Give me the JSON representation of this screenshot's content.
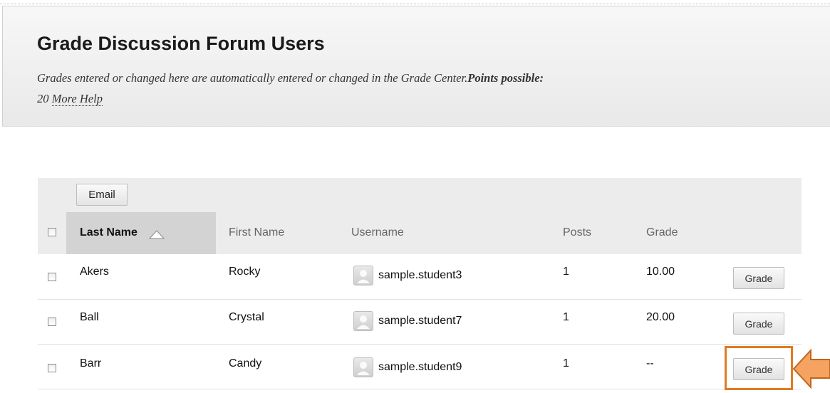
{
  "header": {
    "title": "Grade Discussion Forum Users",
    "help_text": "Grades entered or changed here are automatically entered or changed in the Grade Center.",
    "points_label": "Points possible:",
    "points_value": "20",
    "more_help": "More Help"
  },
  "toolbar": {
    "email_label": "Email"
  },
  "columns": {
    "last_name": "Last Name",
    "first_name": "First Name",
    "username": "Username",
    "posts": "Posts",
    "grade": "Grade"
  },
  "rows": [
    {
      "last_name": "Akers",
      "first_name": "Rocky",
      "username": "sample.student3",
      "posts": "1",
      "grade": "10.00",
      "action": "Grade"
    },
    {
      "last_name": "Ball",
      "first_name": "Crystal",
      "username": "sample.student7",
      "posts": "1",
      "grade": "20.00",
      "action": "Grade"
    },
    {
      "last_name": "Barr",
      "first_name": "Candy",
      "username": "sample.student9",
      "posts": "1",
      "grade": "--",
      "action": "Grade"
    }
  ],
  "colors": {
    "highlight": "#e07a24",
    "arrow_fill": "#f4a460",
    "sorted_column_bg": "#d3d3d3",
    "grid_header_bg": "#ececec"
  },
  "icons": {
    "sort": "sort-ascending-icon",
    "avatar": "user-avatar-icon",
    "arrow": "arrow-left-icon"
  }
}
